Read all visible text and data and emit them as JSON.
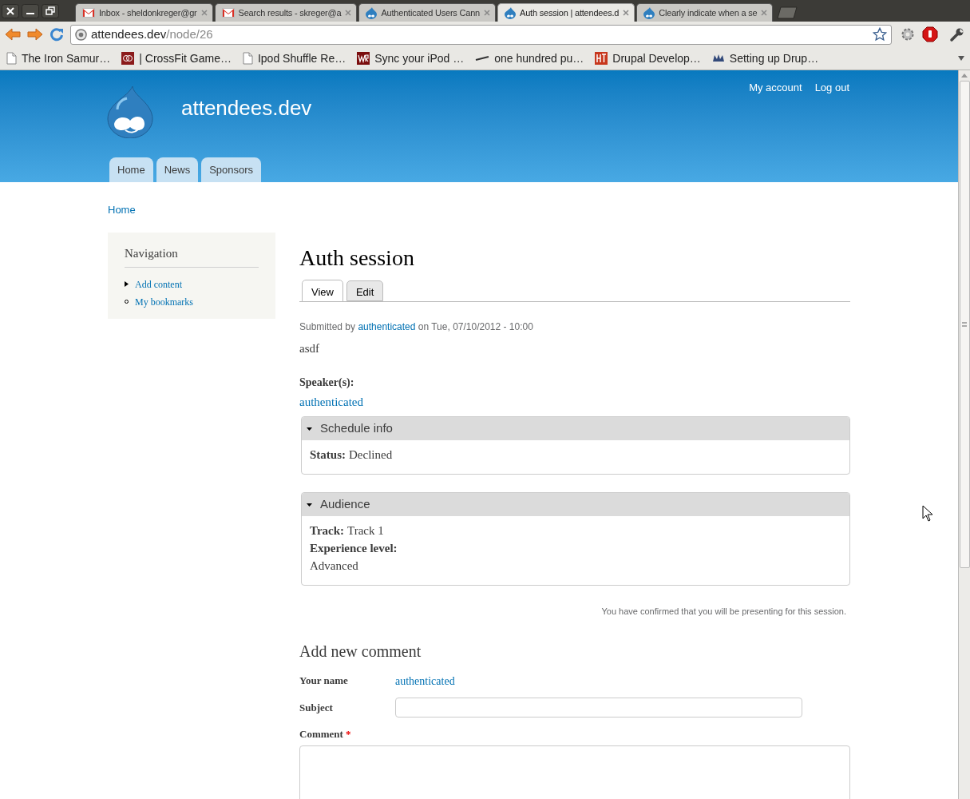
{
  "browser": {
    "tabs": [
      {
        "title": "Inbox - sheldonkreger@gr",
        "kind": "mail",
        "selected": false
      },
      {
        "title": "Search results - skreger@a",
        "kind": "mail",
        "selected": false
      },
      {
        "title": "Authenticated Users Cann",
        "kind": "drop",
        "selected": false
      },
      {
        "title": "Auth session | attendees.d",
        "kind": "drop",
        "selected": true
      },
      {
        "title": "Clearly indicate when a se",
        "kind": "drop",
        "selected": false
      }
    ],
    "address": {
      "host": "attendees.dev",
      "path": "/node/26"
    },
    "bookmarks": [
      {
        "label": "The Iron Samur…",
        "kind": "page"
      },
      {
        "label": "| CrossFit Game…",
        "kind": "rings"
      },
      {
        "label": "Ipod Shuffle Re…",
        "kind": "page"
      },
      {
        "label": "Sync your iPod …",
        "kind": "wr"
      },
      {
        "label": "one hundred pu…",
        "kind": "bar"
      },
      {
        "label": "Drupal Develop…",
        "kind": "ht"
      },
      {
        "label": "Setting up Drup…",
        "kind": "crown"
      }
    ]
  },
  "site": {
    "name": "attendees.dev",
    "user_menu": [
      "My account",
      "Log out"
    ],
    "main_menu": [
      "Home",
      "News",
      "Sponsors"
    ],
    "breadcrumb": "Home"
  },
  "sidebar": {
    "title": "Navigation",
    "items": [
      {
        "label": "Add content",
        "kind": "collapsed"
      },
      {
        "label": "My bookmarks",
        "kind": "leaf"
      }
    ]
  },
  "node": {
    "title": "Auth session",
    "tabs": [
      {
        "label": "View",
        "selected": true
      },
      {
        "label": "Edit",
        "selected": false
      }
    ],
    "submitted": {
      "prefix": "Submitted by",
      "author": "authenticated",
      "suffix": "on Tue, 07/10/2012 - 10:00"
    },
    "body": "asdf",
    "speakers": {
      "label": "Speaker(s):",
      "value": "authenticated"
    },
    "fieldsets": [
      {
        "legend": "Schedule info",
        "expanded": true,
        "fields": [
          {
            "label": "Status:",
            "value": "Declined",
            "kind": "inline"
          }
        ]
      },
      {
        "legend": "Audience",
        "expanded": true,
        "fields": [
          {
            "label": "Track:",
            "value": "Track 1",
            "kind": "inline"
          },
          {
            "label": "Experience level:",
            "value": "Advanced",
            "kind": "above"
          }
        ]
      }
    ],
    "notice": "You have confirmed that you will be presenting for this session."
  },
  "comment_form": {
    "title": "Add new comment",
    "name": {
      "label": "Your name",
      "value": "authenticated"
    },
    "subject": {
      "label": "Subject"
    },
    "comment": {
      "label": "Comment",
      "required_mark": "*"
    }
  }
}
